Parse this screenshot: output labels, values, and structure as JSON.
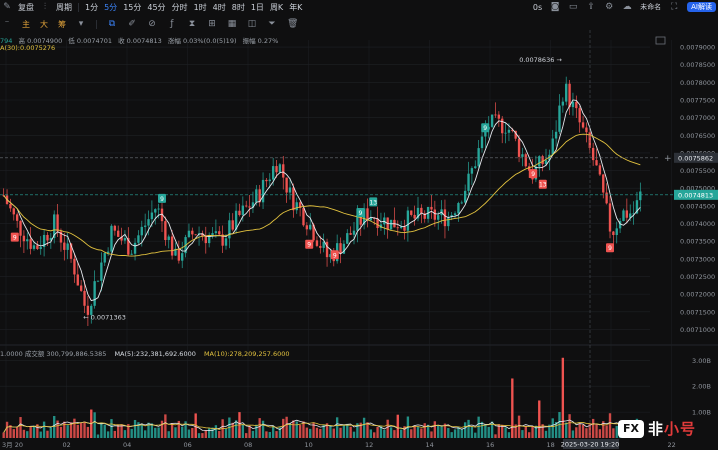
{
  "toolbar": {
    "restore": "复盘",
    "period": "周期",
    "intervals": [
      "1分",
      "5分",
      "15分",
      "45分",
      "分时",
      "1时",
      "4时",
      "8时",
      "1日",
      "周K",
      "年K"
    ],
    "active_interval": "5分",
    "chars": [
      "主",
      "大",
      "筹"
    ],
    "zero_label": "0s",
    "account": "未命名",
    "ai_button": "AI解读"
  },
  "ohlc": {
    "prefix": "794",
    "high": "高 0.0074900",
    "low": "低 0.0074701",
    "close": "收 0.0074813",
    "change": "涨幅 0.03%(0.0(5)19)",
    "amplitude": "振幅 0.27%"
  },
  "ma_label": "A(30):0.0075276",
  "volume_info": {
    "label": "1.0000",
    "turnover": "成交额 300,799,886.5385",
    "ma5": "MA(5):232,381,692.6000",
    "ma10": "MA(10):278,209,257.6000"
  },
  "colors": {
    "up": "#27a69a",
    "down": "#ef5350",
    "ma_fast": "#e6e9ee",
    "ma_slow": "#e2c23f",
    "bg": "#0f0f10",
    "grid": "#1e2024",
    "price_badge": "#2d3138"
  },
  "watermark": {
    "logo": "FX",
    "text_a": "非",
    "text_b": "小号"
  },
  "chart_data": {
    "type": "candlestick",
    "price_axis": {
      "ticks": [
        "0.0079000",
        "0.0078500",
        "0.0078000",
        "0.0077500",
        "0.0077000",
        "0.0076500",
        "0.0076000",
        "0.0075500",
        "0.0075000",
        "0.0074500",
        "0.0074000",
        "0.0073500",
        "0.0073000",
        "0.0072500",
        "0.0072000",
        "0.0071500",
        "0.0071000"
      ],
      "ylim": [
        0.00707,
        0.00792
      ]
    },
    "volume_axis": {
      "ticks": [
        "3.00B",
        "2.00B",
        "1.00B"
      ],
      "ylim": [
        0,
        3.4
      ]
    },
    "x_ticks": [
      "3月 20",
      "02",
      "04",
      "06",
      "08",
      "10",
      "12",
      "14",
      "16",
      "18",
      "20",
      "22"
    ],
    "current_time": "2025-03-20 19:20",
    "current_price": "0.0074813",
    "crosshair_price": "0.0075862",
    "high_label": "0.0078636",
    "low_label": "0.0071363",
    "td_markers": [
      {
        "text": "9",
        "kind": "down",
        "x": 0.02,
        "price": 0.00736
      },
      {
        "text": "9",
        "kind": "up",
        "x": 0.25,
        "price": 0.00747
      },
      {
        "text": "9",
        "kind": "down",
        "x": 0.48,
        "price": 0.00734
      },
      {
        "text": "9",
        "kind": "down",
        "x": 0.52,
        "price": 0.00731
      },
      {
        "text": "9",
        "kind": "up",
        "x": 0.56,
        "price": 0.00743
      },
      {
        "text": "13",
        "kind": "up",
        "x": 0.58,
        "price": 0.00746
      },
      {
        "text": "9",
        "kind": "up",
        "x": 0.755,
        "price": 0.00767
      },
      {
        "text": "9",
        "kind": "down",
        "x": 0.83,
        "price": 0.00754
      },
      {
        "text": "13",
        "kind": "down",
        "x": 0.845,
        "price": 0.00751
      },
      {
        "text": "9",
        "kind": "down",
        "x": 0.95,
        "price": 0.00733
      }
    ],
    "anchors": [
      [
        0.0,
        0.00748
      ],
      [
        0.02,
        0.0074
      ],
      [
        0.05,
        0.00733
      ],
      [
        0.08,
        0.0074
      ],
      [
        0.11,
        0.00728
      ],
      [
        0.13,
        0.00715
      ],
      [
        0.145,
        0.00724
      ],
      [
        0.17,
        0.00738
      ],
      [
        0.2,
        0.00733
      ],
      [
        0.24,
        0.00745
      ],
      [
        0.27,
        0.0073
      ],
      [
        0.3,
        0.00738
      ],
      [
        0.34,
        0.00735
      ],
      [
        0.37,
        0.00742
      ],
      [
        0.4,
        0.00748
      ],
      [
        0.43,
        0.00758
      ],
      [
        0.45,
        0.00748
      ],
      [
        0.48,
        0.0074
      ],
      [
        0.51,
        0.0073
      ],
      [
        0.54,
        0.00736
      ],
      [
        0.57,
        0.00743
      ],
      [
        0.61,
        0.0074
      ],
      [
        0.66,
        0.00742
      ],
      [
        0.7,
        0.00742
      ],
      [
        0.73,
        0.00752
      ],
      [
        0.76,
        0.00768
      ],
      [
        0.79,
        0.00768
      ],
      [
        0.83,
        0.00754
      ],
      [
        0.86,
        0.0076
      ],
      [
        0.88,
        0.00779
      ],
      [
        0.91,
        0.00766
      ],
      [
        0.93,
        0.00756
      ],
      [
        0.955,
        0.00737
      ],
      [
        0.97,
        0.00743
      ],
      [
        0.99,
        0.00743
      ],
      [
        1.0,
        0.00748
      ]
    ]
  }
}
